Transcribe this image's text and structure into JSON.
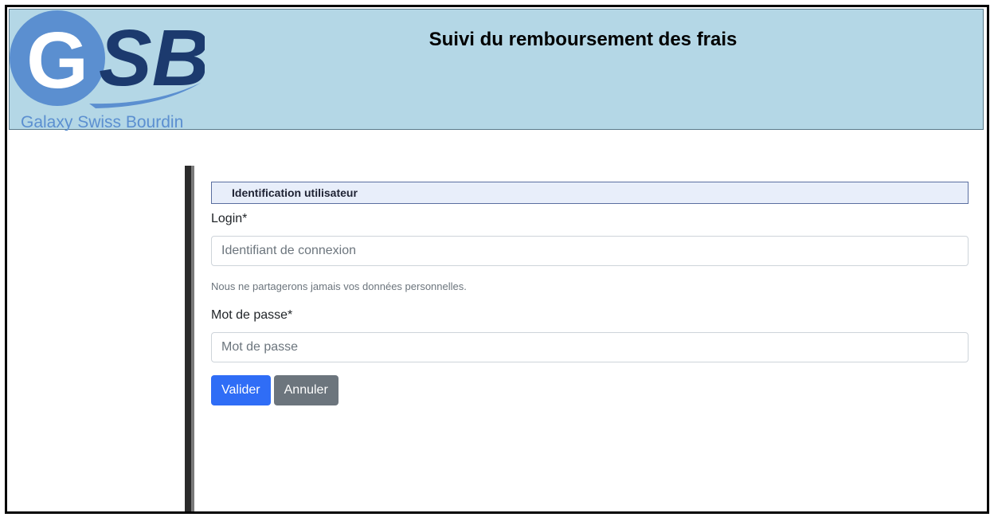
{
  "header": {
    "logo": {
      "initials": "GSB",
      "company_name": "Galaxy Swiss Bourdin"
    },
    "title": "Suivi du remboursement des frais"
  },
  "form": {
    "legend": "Identification utilisateur",
    "login": {
      "label": "Login*",
      "placeholder": "Identifiant de connexion",
      "value": "",
      "help": "Nous ne partagerons jamais vos données personnelles."
    },
    "password": {
      "label": "Mot de passe*",
      "placeholder": "Mot de passe",
      "value": ""
    },
    "submit_label": "Valider",
    "cancel_label": "Annuler"
  },
  "colors": {
    "header_bg": "#b4d7e6",
    "logo_light_blue": "#5b8fd0",
    "logo_dark_blue": "#1c3a6e",
    "primary_button": "#2f6df6",
    "secondary_button": "#6c757d"
  }
}
